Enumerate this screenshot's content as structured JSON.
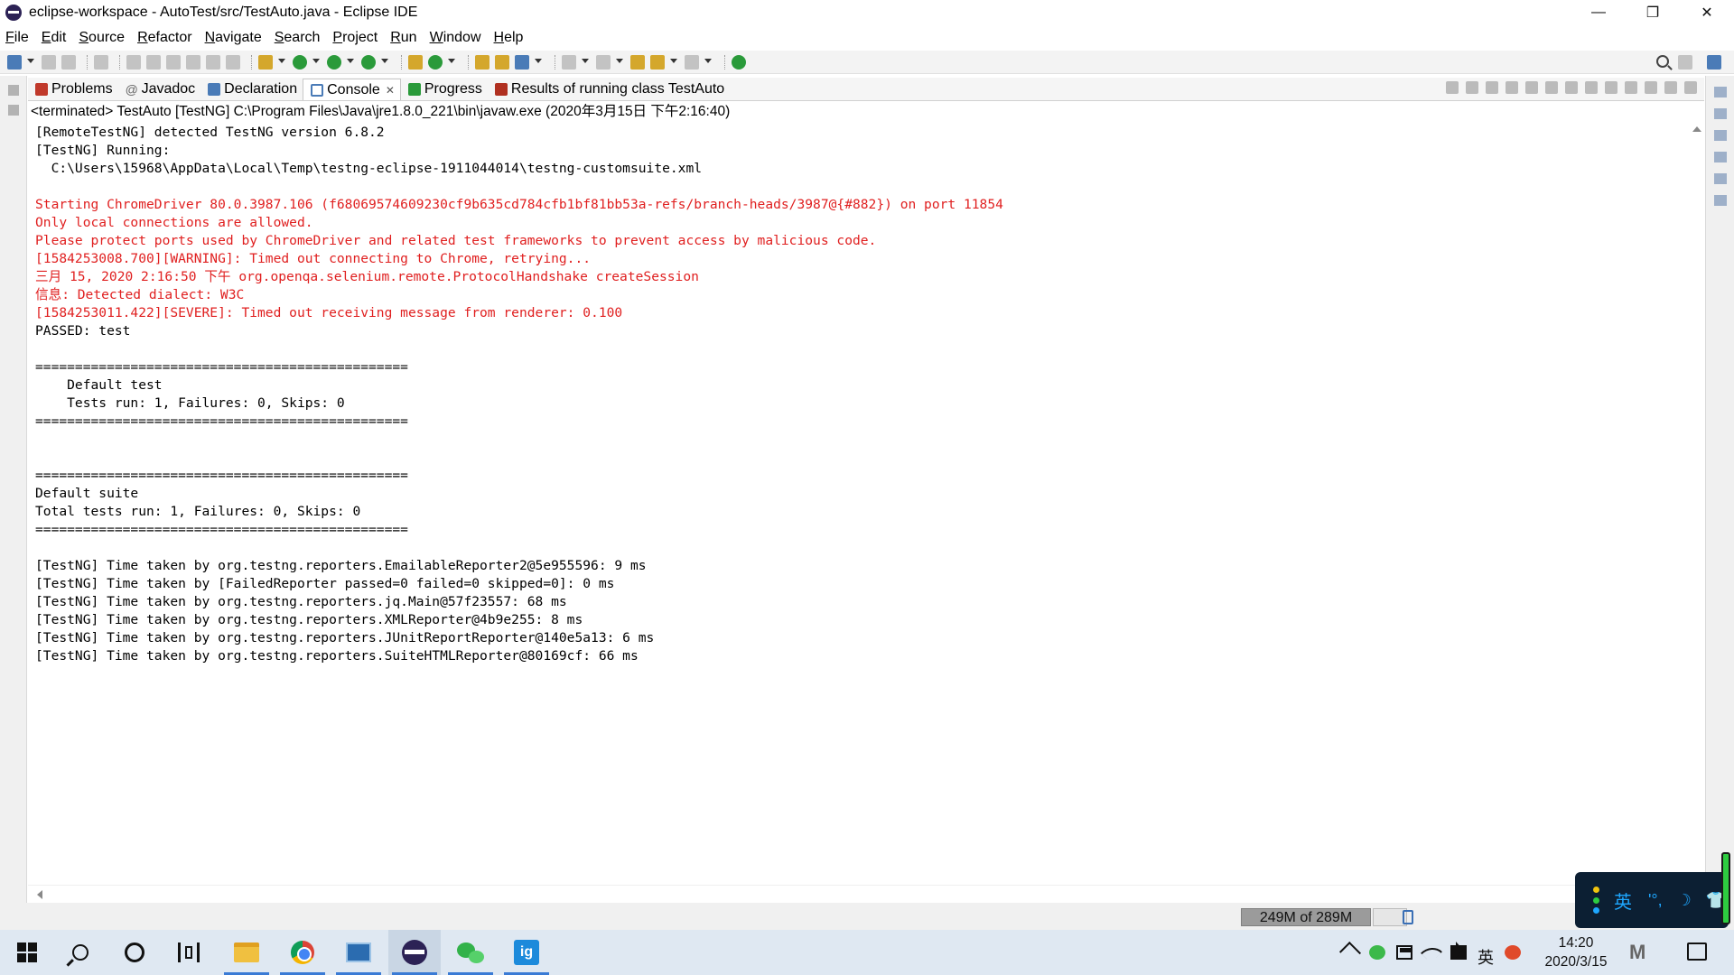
{
  "window": {
    "title": "eclipse-workspace - AutoTest/src/TestAuto.java - Eclipse IDE",
    "minimize": "—",
    "restore": "❐",
    "close": "✕"
  },
  "menu": [
    "File",
    "Edit",
    "Source",
    "Refactor",
    "Navigate",
    "Search",
    "Project",
    "Run",
    "Window",
    "Help"
  ],
  "tabs": [
    {
      "label": "Problems",
      "icon": "problems-icon",
      "color": "#c0392b"
    },
    {
      "label": "Javadoc",
      "icon": "at-icon",
      "color": "#666666"
    },
    {
      "label": "Declaration",
      "icon": "declaration-icon",
      "color": "#4a7bb7"
    },
    {
      "label": "Console",
      "icon": "console-icon",
      "color": "#4a7bb7",
      "close": "✕"
    },
    {
      "label": "Progress",
      "icon": "progress-icon",
      "color": "#2a9a3a"
    },
    {
      "label": "Results of running class TestAuto",
      "icon": "testng-icon",
      "color": "#b03020"
    }
  ],
  "console": {
    "header": "<terminated> TestAuto [TestNG] C:\\Program Files\\Java\\jre1.8.0_221\\bin\\javaw.exe (2020年3月15日 下午2:16:40)",
    "lines": [
      {
        "text": "[RemoteTestNG] detected TestNG version 6.8.2",
        "color": "black"
      },
      {
        "text": "[TestNG] Running:",
        "color": "black"
      },
      {
        "text": "  C:\\Users\\15968\\AppData\\Local\\Temp\\testng-eclipse-1911044014\\testng-customsuite.xml",
        "color": "black"
      },
      {
        "text": "",
        "color": "black"
      },
      {
        "text": "Starting ChromeDriver 80.0.3987.106 (f68069574609230cf9b635cd784cfb1bf81bb53a-refs/branch-heads/3987@{#882}) on port 11854",
        "color": "red"
      },
      {
        "text": "Only local connections are allowed.",
        "color": "red"
      },
      {
        "text": "Please protect ports used by ChromeDriver and related test frameworks to prevent access by malicious code.",
        "color": "red"
      },
      {
        "text": "[1584253008.700][WARNING]: Timed out connecting to Chrome, retrying...",
        "color": "red"
      },
      {
        "text": "三月 15, 2020 2:16:50 下午 org.openqa.selenium.remote.ProtocolHandshake createSession",
        "color": "red"
      },
      {
        "text": "信息: Detected dialect: W3C",
        "color": "red"
      },
      {
        "text": "[1584253011.422][SEVERE]: Timed out receiving message from renderer: 0.100",
        "color": "red"
      },
      {
        "text": "PASSED: test",
        "color": "black"
      },
      {
        "text": "",
        "color": "black"
      },
      {
        "text": "===============================================",
        "color": "black"
      },
      {
        "text": "    Default test",
        "color": "black"
      },
      {
        "text": "    Tests run: 1, Failures: 0, Skips: 0",
        "color": "black"
      },
      {
        "text": "===============================================",
        "color": "black"
      },
      {
        "text": "",
        "color": "black"
      },
      {
        "text": "",
        "color": "black"
      },
      {
        "text": "===============================================",
        "color": "black"
      },
      {
        "text": "Default suite",
        "color": "black"
      },
      {
        "text": "Total tests run: 1, Failures: 0, Skips: 0",
        "color": "black"
      },
      {
        "text": "===============================================",
        "color": "black"
      },
      {
        "text": "",
        "color": "black"
      },
      {
        "text": "[TestNG] Time taken by org.testng.reporters.EmailableReporter2@5e955596: 9 ms",
        "color": "black"
      },
      {
        "text": "[TestNG] Time taken by [FailedReporter passed=0 failed=0 skipped=0]: 0 ms",
        "color": "black"
      },
      {
        "text": "[TestNG] Time taken by org.testng.reporters.jq.Main@57f23557: 68 ms",
        "color": "black"
      },
      {
        "text": "[TestNG] Time taken by org.testng.reporters.XMLReporter@4b9e255: 8 ms",
        "color": "black"
      },
      {
        "text": "[TestNG] Time taken by org.testng.reporters.JUnitReportReporter@140e5a13: 6 ms",
        "color": "black"
      },
      {
        "text": "[TestNG] Time taken by org.testng.reporters.SuiteHTMLReporter@80169cf: 66 ms",
        "color": "black"
      }
    ]
  },
  "status": {
    "heap": "249M of 289M"
  },
  "ime": {
    "lang": "英",
    "punct": "'°,",
    "moon": "☽",
    "shirt": "👕",
    "tray_lang": "英"
  },
  "taskbar": {
    "time": "14:20",
    "date": "2020/3/15",
    "ig_label": "ig"
  },
  "colors": {
    "red_output": "#e02020",
    "taskbar_bg": "#dfe8f2"
  }
}
